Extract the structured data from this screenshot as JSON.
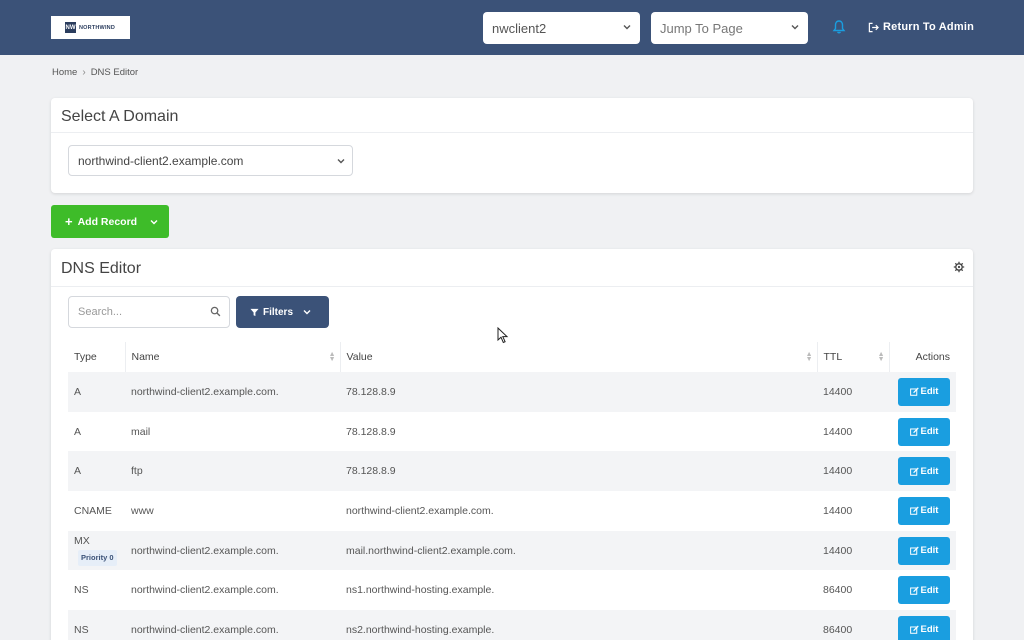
{
  "header": {
    "logo_text": "NORTHWIND",
    "logo_mark": "NW",
    "client_select_value": "nwclient2",
    "jump_placeholder": "Jump To Page",
    "return_label": "Return To Admin",
    "bell_icon": "bell-icon",
    "colors": {
      "bar": "#3b5278",
      "bell": "#1a9ee0"
    }
  },
  "breadcrumb": {
    "home": "Home",
    "current": "DNS Editor"
  },
  "domain_card": {
    "title": "Select A Domain",
    "selected_domain": "northwind-client2.example.com"
  },
  "add_record": {
    "label": "Add Record",
    "color": "#3ebc29"
  },
  "dns_card": {
    "title": "DNS Editor",
    "search_placeholder": "Search...",
    "filters_label": "Filters",
    "columns": [
      "Type",
      "Name",
      "Value",
      "TTL",
      "Actions"
    ],
    "edit_label": "Edit",
    "rows": [
      {
        "type": "A",
        "name": "northwind-client2.example.com.",
        "value": "78.128.8.9",
        "ttl": "14400"
      },
      {
        "type": "A",
        "name": "mail",
        "value": "78.128.8.9",
        "ttl": "14400"
      },
      {
        "type": "A",
        "name": "ftp",
        "value": "78.128.8.9",
        "ttl": "14400"
      },
      {
        "type": "CNAME",
        "name": "www",
        "value": "northwind-client2.example.com.",
        "ttl": "14400"
      },
      {
        "type": "MX",
        "priority": "Priority 0",
        "name": "northwind-client2.example.com.",
        "value": "mail.northwind-client2.example.com.",
        "ttl": "14400"
      },
      {
        "type": "NS",
        "name": "northwind-client2.example.com.",
        "value": "ns1.northwind-hosting.example.",
        "ttl": "86400"
      },
      {
        "type": "NS",
        "name": "northwind-client2.example.com.",
        "value": "ns2.northwind-hosting.example.",
        "ttl": "86400"
      }
    ]
  }
}
